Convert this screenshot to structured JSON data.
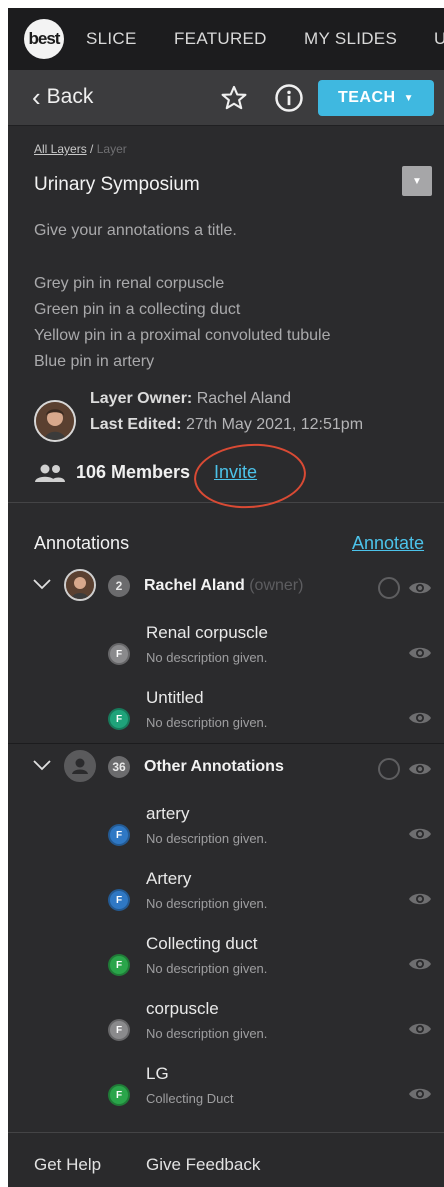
{
  "nav": {
    "logo": "best",
    "items": [
      "SLICE",
      "FEATURED",
      "MY SLIDES",
      "U"
    ]
  },
  "toolbar": {
    "back_label": "Back",
    "teach_label": "TEACH"
  },
  "layer": {
    "breadcrumb": {
      "root": "All Layers",
      "separator": "/",
      "current": "Layer"
    },
    "title": "Urinary Symposium",
    "description": [
      "Give your annotations a title.",
      "",
      "Grey pin in renal corpuscle",
      "Green pin in a collecting duct",
      "Yellow pin in a proximal convoluted tubule",
      "Blue pin in artery"
    ],
    "owner_label": "Layer Owner:",
    "owner_name": "Rachel Aland",
    "edited_label": "Last Edited:",
    "edited_value": "27th May 2021, 12:51pm",
    "members": "106 Members",
    "invite": "Invite"
  },
  "annotations": {
    "header": "Annotations",
    "annotate_link": "Annotate",
    "groups": [
      {
        "count": "2",
        "name": "Rachel Aland",
        "tag": "(owner)",
        "items": [
          {
            "name": "Renal corpuscle",
            "desc": "No description given.",
            "badge": "F",
            "color": "#8a8a8c"
          },
          {
            "name": "Untitled",
            "desc": "No description given.",
            "badge": "F",
            "color": "#1fa37a"
          }
        ]
      },
      {
        "count": "36",
        "name": "Other Annotations",
        "tag": "",
        "items": [
          {
            "name": "artery",
            "desc": "No description given.",
            "badge": "F",
            "color": "#2f78c4"
          },
          {
            "name": "Artery",
            "desc": "No description given.",
            "badge": "F",
            "color": "#2f78c4"
          },
          {
            "name": "Collecting duct",
            "desc": "No description given.",
            "badge": "F",
            "color": "#2aa54a"
          },
          {
            "name": "corpuscle",
            "desc": "No description given.",
            "badge": "F",
            "color": "#8a8a8c"
          },
          {
            "name": "LG",
            "desc": "Collecting Duct",
            "badge": "F",
            "color": "#2aa54a"
          }
        ]
      }
    ]
  },
  "footer": {
    "help": "Get Help",
    "feedback": "Give Feedback"
  },
  "colors": {
    "accent": "#3fb8e0",
    "link": "#4cc3ea",
    "annotation_circle": "#d94a34"
  }
}
